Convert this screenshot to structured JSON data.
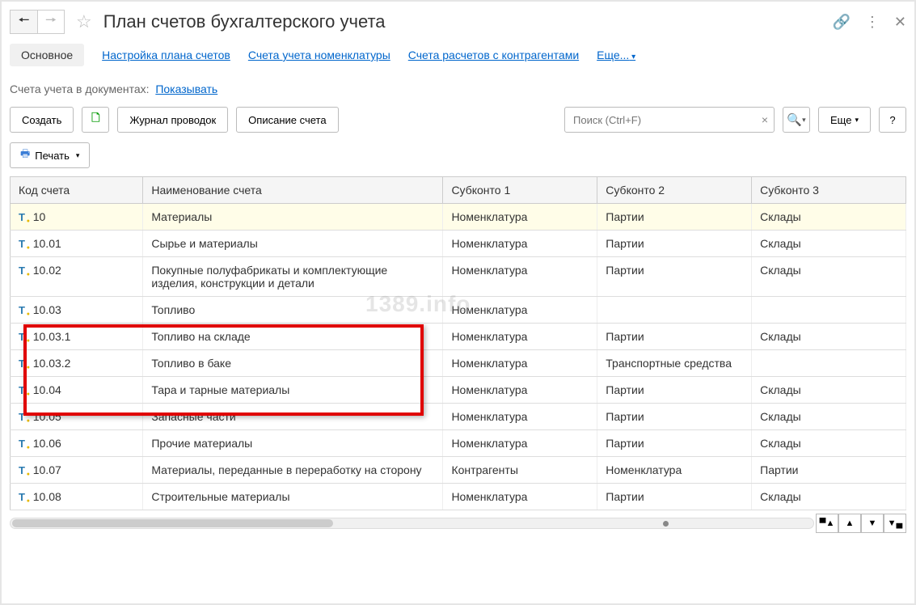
{
  "header": {
    "title": "План счетов бухгалтерского учета"
  },
  "tabs": {
    "main": "Основное",
    "setup": "Настройка плана счетов",
    "nomenclature": "Счета учета номенклатуры",
    "counterparties": "Счета расчетов с контрагентами",
    "more": "Еще..."
  },
  "docs": {
    "label": "Счета учета в документах:",
    "link": "Показывать"
  },
  "toolbar": {
    "create": "Создать",
    "journal": "Журнал проводок",
    "description": "Описание счета",
    "search_placeholder": "Поиск (Ctrl+F)",
    "more": "Еще",
    "help": "?",
    "print": "Печать"
  },
  "table": {
    "headers": {
      "code": "Код счета",
      "name": "Наименование счета",
      "sub1": "Субконто 1",
      "sub2": "Субконто 2",
      "sub3": "Субконто 3"
    },
    "rows": [
      {
        "code": "10",
        "name": "Материалы",
        "sub1": "Номенклатура",
        "sub2": "Партии",
        "sub3": "Склады",
        "selected": true
      },
      {
        "code": "10.01",
        "name": "Сырье и материалы",
        "sub1": "Номенклатура",
        "sub2": "Партии",
        "sub3": "Склады"
      },
      {
        "code": "10.02",
        "name": "Покупные полуфабрикаты и комплектующие изделия, конструкции и детали",
        "sub1": "Номенклатура",
        "sub2": "Партии",
        "sub3": "Склады"
      },
      {
        "code": "10.03",
        "name": "Топливо",
        "sub1": "Номенклатура",
        "sub2": "",
        "sub3": ""
      },
      {
        "code": "10.03.1",
        "name": "Топливо на складе",
        "sub1": "Номенклатура",
        "sub2": "Партии",
        "sub3": "Склады"
      },
      {
        "code": "10.03.2",
        "name": "Топливо в баке",
        "sub1": "Номенклатура",
        "sub2": "Транспортные средства",
        "sub3": ""
      },
      {
        "code": "10.04",
        "name": "Тара и тарные материалы",
        "sub1": "Номенклатура",
        "sub2": "Партии",
        "sub3": "Склады"
      },
      {
        "code": "10.05",
        "name": "Запасные части",
        "sub1": "Номенклатура",
        "sub2": "Партии",
        "sub3": "Склады"
      },
      {
        "code": "10.06",
        "name": "Прочие материалы",
        "sub1": "Номенклатура",
        "sub2": "Партии",
        "sub3": "Склады"
      },
      {
        "code": "10.07",
        "name": "Материалы, переданные в переработку на сторону",
        "sub1": "Контрагенты",
        "sub2": "Номенклатура",
        "sub3": "Партии"
      },
      {
        "code": "10.08",
        "name": "Строительные материалы",
        "sub1": "Номенклатура",
        "sub2": "Партии",
        "sub3": "Склады"
      }
    ]
  },
  "watermark": "1389.info"
}
